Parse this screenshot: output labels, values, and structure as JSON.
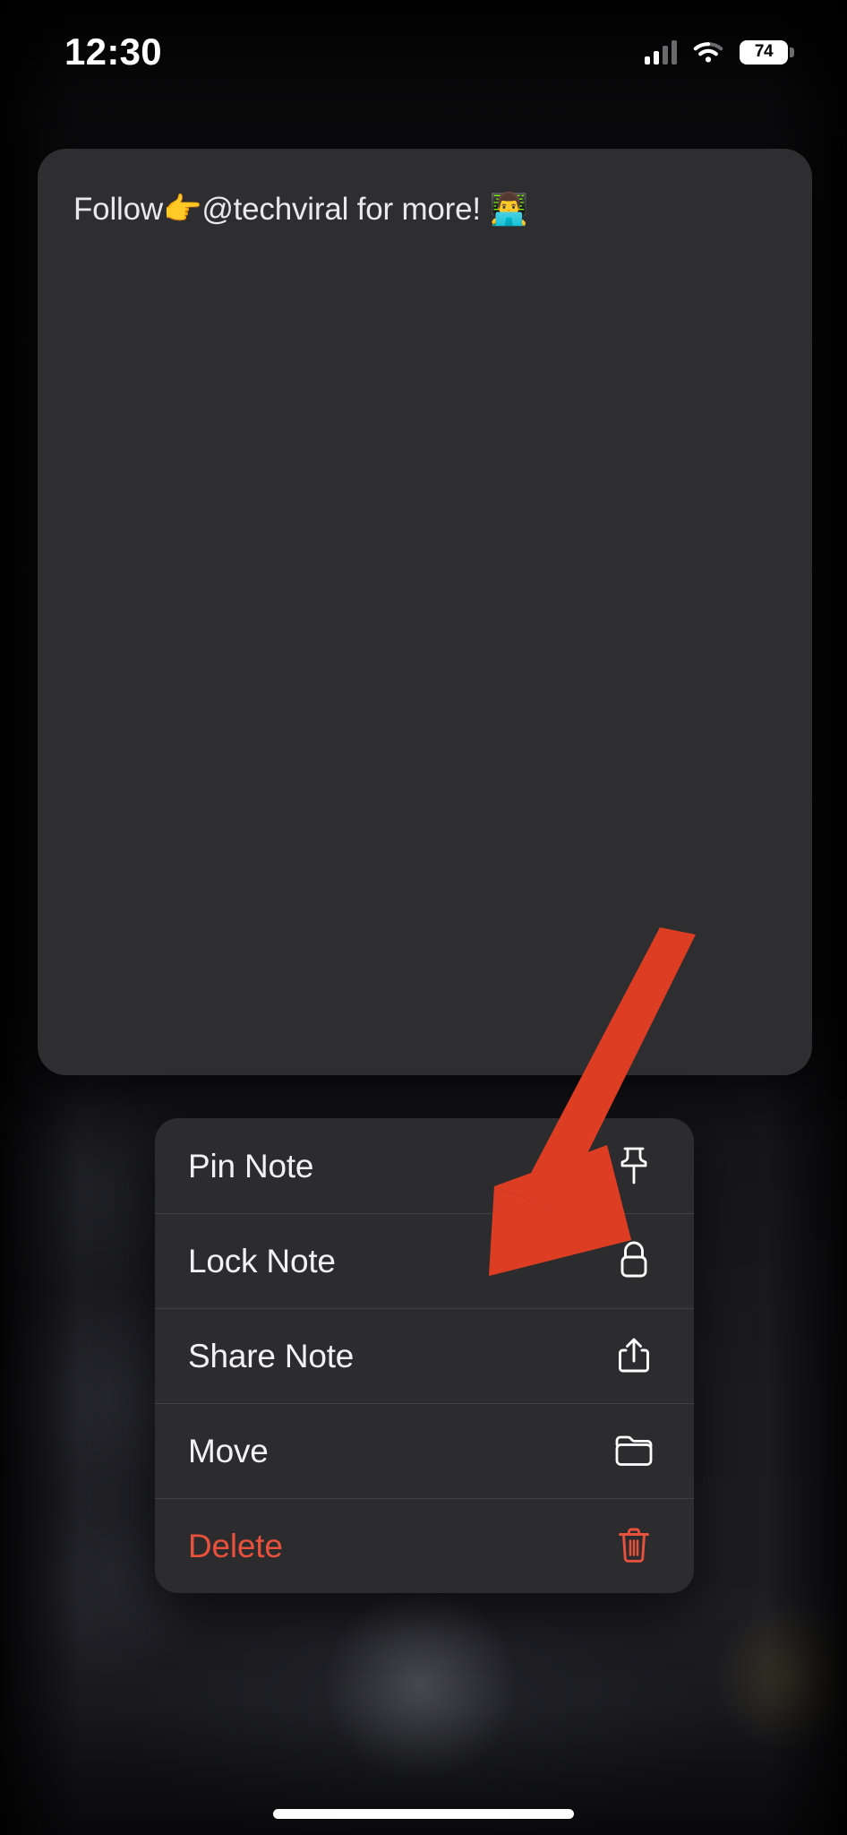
{
  "status_bar": {
    "time": "12:30",
    "battery_percent": "74",
    "cellular_icon": "cellular-bars-icon",
    "wifi_icon": "wifi-icon",
    "battery_icon": "battery-icon"
  },
  "note_card": {
    "text": "Follow👉@techviral for more! 👨‍💻"
  },
  "context_menu": {
    "items": [
      {
        "label": "Pin Note",
        "icon": "pin-icon",
        "destructive": false
      },
      {
        "label": "Lock Note",
        "icon": "lock-icon",
        "destructive": false
      },
      {
        "label": "Share Note",
        "icon": "share-icon",
        "destructive": false
      },
      {
        "label": "Move",
        "icon": "folder-icon",
        "destructive": false
      },
      {
        "label": "Delete",
        "icon": "trash-icon",
        "destructive": true
      }
    ]
  },
  "annotation": {
    "arrow_color": "#DD3D22",
    "arrow_points_to": "Lock Note"
  },
  "colors": {
    "card_background": "#2e2e30",
    "menu_background": "#2c2c2e",
    "destructive_text": "#e8513c",
    "primary_text": "#f2f2f4",
    "accent_red": "#DD3D22"
  },
  "home_indicator": {
    "name": "home-indicator"
  }
}
